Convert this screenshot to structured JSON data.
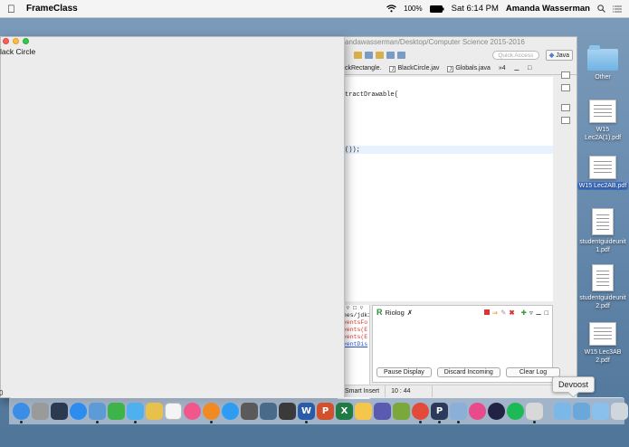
{
  "menubar": {
    "app_name": "FrameClass",
    "battery": "100%",
    "time": "Sat 6:14 PM",
    "user": "Amanda Wasserman"
  },
  "eclipse": {
    "title": "andawasserman/Desktop/Computer Science 2015-2016",
    "quick_access": "Quick Access",
    "perspective": "Java",
    "tabs": [
      "ckRectangle.",
      "BlackCircle.jav",
      "Globals.java",
      "»4"
    ],
    "code_lines": [
      "tractDrawable{",
      "());"
    ],
    "console_left": [
      {
        "text": "□ ▿ □ ▿",
        "style": "plain"
      },
      {
        "text": "ines/jdk1.8",
        "style": "plain"
      },
      {
        "text": "EventsFo",
        "style": "red"
      },
      {
        "text": "Events(E",
        "style": "red"
      },
      {
        "text": "Events(E",
        "style": "red"
      },
      {
        "text": "EventDis",
        "style": "blue"
      }
    ],
    "riolog": {
      "title": "Riolog",
      "tab_close": "✗",
      "buttons": [
        "Pause Display",
        "Discard Incoming",
        "Clear Log"
      ]
    },
    "status": {
      "insert_mode": "Smart Insert",
      "position": "10 : 44"
    }
  },
  "frame": {
    "title": "lack Circle",
    "corner_text": "0"
  },
  "desktop_icons": [
    {
      "label": "Other",
      "kind": "folder"
    },
    {
      "label": "W15 Lec2A(1).pdf",
      "kind": "doc"
    },
    {
      "label": "W15 Lec2AB.pdf",
      "kind": "doc"
    },
    {
      "label": "studentguideunit 1.pdf",
      "kind": "doc"
    },
    {
      "label": "studentguideunit 2.pdf",
      "kind": "doc"
    },
    {
      "label": "W15 Lec3AB 2.pdf",
      "kind": "doc"
    }
  ],
  "tooltip": "Devpost",
  "dock": {
    "apps": [
      {
        "name": "finder",
        "color": "#3a8ee6"
      },
      {
        "name": "launchpad",
        "color": "#9a9a9a"
      },
      {
        "name": "mission-control",
        "color": "#2b3a4f"
      },
      {
        "name": "app-store",
        "color": "#2d8cf0"
      },
      {
        "name": "preview",
        "color": "#5c9bd6"
      },
      {
        "name": "facetime",
        "color": "#3cb44a"
      },
      {
        "name": "messages",
        "color": "#4fb0f0"
      },
      {
        "name": "notes",
        "color": "#e8c14a"
      },
      {
        "name": "calendar",
        "color": "#f4f4f4"
      },
      {
        "name": "itunes",
        "color": "#f2578b"
      },
      {
        "name": "ibooks",
        "color": "#f08a24"
      },
      {
        "name": "safari",
        "color": "#2e9cf2"
      },
      {
        "name": "chess",
        "color": "#5a5a5a"
      },
      {
        "name": "time-machine",
        "color": "#4a6a8a"
      },
      {
        "name": "steam",
        "color": "#3a3a3a"
      },
      {
        "name": "word",
        "color": "#2b5aa8"
      },
      {
        "name": "powerpoint",
        "color": "#d2502c"
      },
      {
        "name": "excel",
        "color": "#1f7a43"
      },
      {
        "name": "photos",
        "color": "#f6c64a"
      },
      {
        "name": "eclipse",
        "color": "#5a5ab0"
      },
      {
        "name": "mail",
        "color": "#7aa83a"
      },
      {
        "name": "chrome",
        "color": "#e24a3a"
      },
      {
        "name": "p-app",
        "color": "#2b3a5a"
      },
      {
        "name": "photo-booth",
        "color": "#8ab0d8"
      },
      {
        "name": "pinwheel",
        "color": "#e84a8a"
      },
      {
        "name": "ball-app",
        "color": "#222244"
      },
      {
        "name": "spotify",
        "color": "#1db954"
      },
      {
        "name": "installer",
        "color": "#d8d8d8"
      }
    ],
    "right": [
      {
        "name": "folder-stack",
        "color": "#7ab8e8"
      },
      {
        "name": "downloads-stack",
        "color": "#6aa8dc"
      },
      {
        "name": "documents-stack",
        "color": "#8ac0ec"
      },
      {
        "name": "trash",
        "color": "#cfd6dc"
      }
    ],
    "glyphs": {
      "word": "W",
      "powerpoint": "P",
      "excel": "X",
      "p-app": "P"
    }
  }
}
